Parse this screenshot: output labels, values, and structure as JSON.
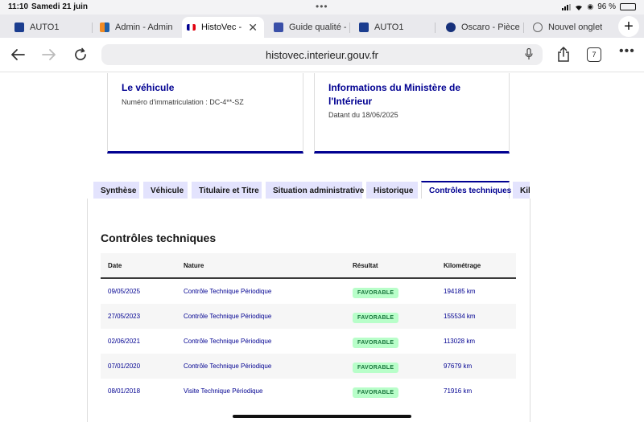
{
  "status_bar": {
    "time": "11:10",
    "date": "Samedi 21 juin",
    "battery": "96 %",
    "battery_level": 0.96
  },
  "browser_tabs": [
    {
      "label": "AUTO1",
      "icon": "auto1-favicon",
      "active": false
    },
    {
      "label": "Admin - Admin",
      "icon": "admin-favicon",
      "active": false
    },
    {
      "label": "HistoVec -",
      "icon": "french-flag-favicon",
      "active": true
    },
    {
      "label": "Guide qualité -",
      "icon": "guide-favicon",
      "active": false
    },
    {
      "label": "AUTO1",
      "icon": "auto1-favicon",
      "active": false
    },
    {
      "label": "Oscaro - Pièce",
      "icon": "oscaro-favicon",
      "active": false
    },
    {
      "label": "Nouvel onglet",
      "icon": "globe-icon",
      "active": false
    }
  ],
  "address_bar": {
    "url": "histovec.interieur.gouv.fr",
    "tab_count": "7"
  },
  "vehicle_card": {
    "title": "Le véhicule",
    "subtitle": "Numéro d'immatriculation : DC-4**-SZ"
  },
  "ministry_card": {
    "title_line1": "Informations du Ministère de",
    "title_line2": "l'Intérieur",
    "subtitle": "Datant du 18/06/2025"
  },
  "page_tabs": [
    {
      "label": "Synthèse",
      "active": false
    },
    {
      "label": "Véhicule",
      "active": false
    },
    {
      "label": "Titulaire et Titre",
      "active": false
    },
    {
      "label": "Situation administrative",
      "active": false
    },
    {
      "label": "Historique",
      "active": false
    },
    {
      "label": "Contrôles techniques",
      "active": true
    },
    {
      "label": "Kilo",
      "active": false
    }
  ],
  "section": {
    "title": "Contrôles techniques",
    "columns": [
      "Date",
      "Nature",
      "Résultat",
      "Kilométrage"
    ],
    "rows": [
      {
        "date": "09/05/2025",
        "nature": "Contrôle Technique Périodique",
        "result": "FAVORABLE",
        "km": "194185 km"
      },
      {
        "date": "27/05/2023",
        "nature": "Contrôle Technique Périodique",
        "result": "FAVORABLE",
        "km": "155534 km"
      },
      {
        "date": "02/06/2021",
        "nature": "Contrôle Technique Périodique",
        "result": "FAVORABLE",
        "km": "113028 km"
      },
      {
        "date": "07/01/2020",
        "nature": "Contrôle Technique Périodique",
        "result": "FAVORABLE",
        "km": "97679 km"
      },
      {
        "date": "08/01/2018",
        "nature": "Visite Technique Périodique",
        "result": "FAVORABLE",
        "km": "71916 km"
      }
    ]
  },
  "colors": {
    "accent": "#000091",
    "favorable_bg": "#b8fec9",
    "favorable_text": "#18753c",
    "tab_bg": "#e3e3fd"
  }
}
